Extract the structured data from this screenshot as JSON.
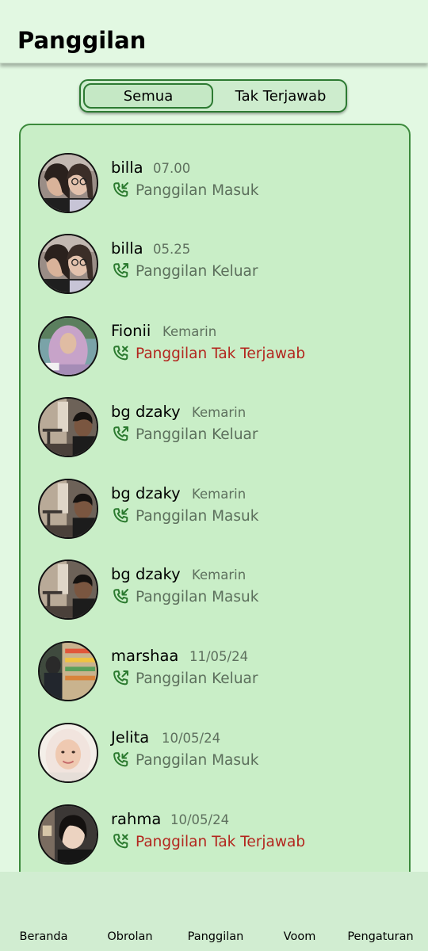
{
  "header": {
    "title": "Panggilan"
  },
  "tabs": {
    "all_label": "Semua",
    "missed_label": "Tak Terjawab"
  },
  "calls": [
    {
      "name": "billa",
      "time": "07.00",
      "status": "Panggilan Masuk",
      "type": "incoming",
      "avatar": "pair"
    },
    {
      "name": "billa",
      "time": "05.25",
      "status": "Panggilan Keluar",
      "type": "outgoing",
      "avatar": "pair"
    },
    {
      "name": "Fionii",
      "time": "Kemarin",
      "status": "Panggilan Tak Terjawab",
      "type": "missed",
      "avatar": "hijab-lilac"
    },
    {
      "name": "bg dzaky",
      "time": "Kemarin",
      "status": "Panggilan Keluar",
      "type": "outgoing",
      "avatar": "cafe"
    },
    {
      "name": "bg dzaky",
      "time": "Kemarin",
      "status": "Panggilan Masuk",
      "type": "incoming",
      "avatar": "cafe"
    },
    {
      "name": "bg dzaky",
      "time": "Kemarin",
      "status": "Panggilan Masuk",
      "type": "incoming",
      "avatar": "cafe"
    },
    {
      "name": "marshaa",
      "time": "11/05/24",
      "status": "Panggilan Keluar",
      "type": "outgoing",
      "avatar": "store"
    },
    {
      "name": "Jelita",
      "time": "10/05/24",
      "status": "Panggilan Masuk",
      "type": "incoming",
      "avatar": "hijab-white"
    },
    {
      "name": "rahma",
      "time": "10/05/24",
      "status": "Panggilan Tak Terjawab",
      "type": "missed",
      "avatar": "dark"
    }
  ],
  "bottom_nav": {
    "home": "Beranda",
    "chats": "Obrolan",
    "calls": "Panggilan",
    "voom": "Voom",
    "settings": "Pengaturan"
  },
  "colors": {
    "background": "#e2f8e2",
    "card": "#c9eec7",
    "accent_green": "#2d7a32",
    "missed_red": "#b3261e",
    "nav": "#d1edd1"
  }
}
